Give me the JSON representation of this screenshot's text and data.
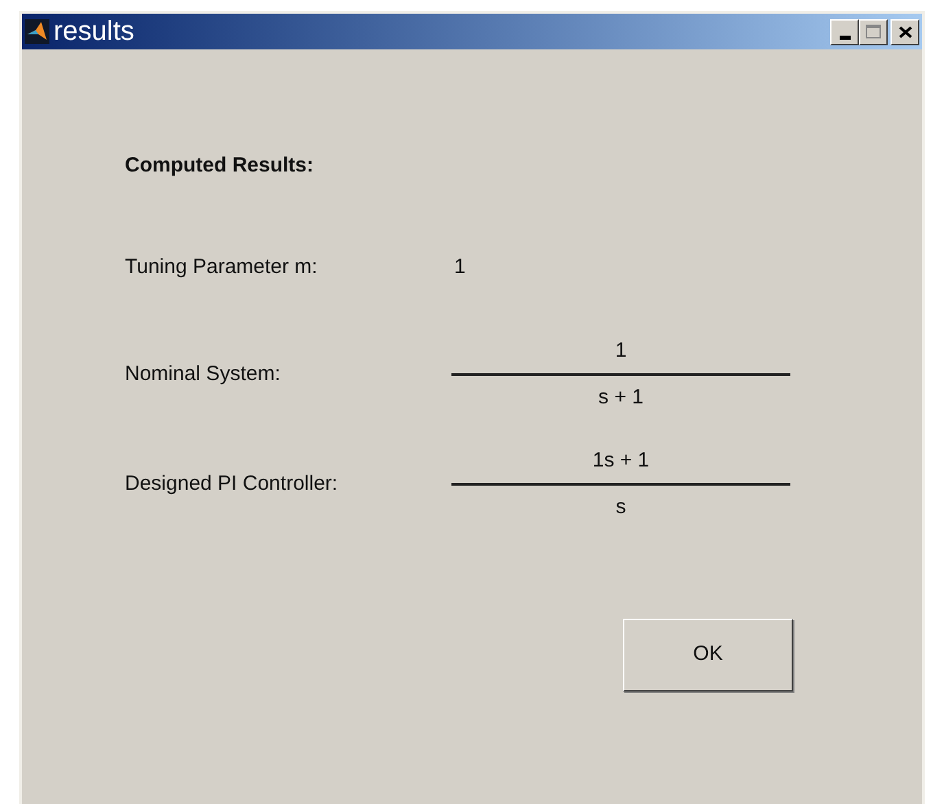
{
  "window": {
    "title": "results"
  },
  "heading": "Computed Results:",
  "tuning": {
    "label": "Tuning Parameter m:",
    "value": "1"
  },
  "transfer_functions": [
    {
      "label": "Nominal System:",
      "numerator": "1",
      "denominator": "s + 1"
    },
    {
      "label": "Designed PI Controller:",
      "numerator": "1s + 1",
      "denominator": "s"
    }
  ],
  "buttons": [
    "OK"
  ]
}
